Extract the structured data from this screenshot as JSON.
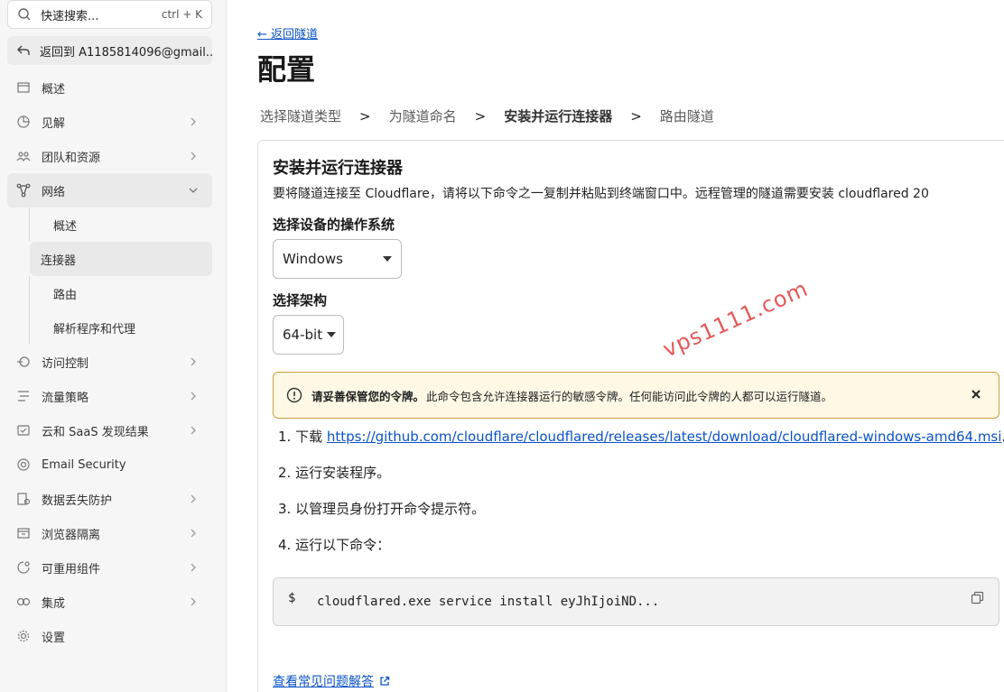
{
  "sidebar": {
    "search": {
      "placeholder": "快速搜索...",
      "shortcut": "ctrl + K"
    },
    "back_account": "返回到 A1185814096@gmail...",
    "items": [
      {
        "label": "概述",
        "icon": "overview-icon"
      },
      {
        "label": "见解",
        "icon": "insights-icon"
      },
      {
        "label": "团队和资源",
        "icon": "team-icon"
      },
      {
        "label": "网络",
        "icon": "network-icon"
      },
      {
        "label": "访问控制",
        "icon": "access-icon"
      },
      {
        "label": "流量策略",
        "icon": "traffic-icon"
      },
      {
        "label": "云和 SaaS 发现结果",
        "icon": "cloud-icon"
      },
      {
        "label": "Email Security",
        "icon": "email-icon"
      },
      {
        "label": "数据丢失防护",
        "icon": "dlp-icon"
      },
      {
        "label": "浏览器隔离",
        "icon": "browser-icon"
      },
      {
        "label": "可重用组件",
        "icon": "component-icon"
      },
      {
        "label": "集成",
        "icon": "integration-icon"
      },
      {
        "label": "设置",
        "icon": "settings-icon"
      }
    ],
    "network_sub": [
      "概述",
      "连接器",
      "路由",
      "解析程序和代理"
    ]
  },
  "main": {
    "back_link": "← 返回隧道",
    "title": "配置",
    "steps": [
      "选择隧道类型",
      "为隧道命名",
      "安装并运行连接器",
      "路由隧道"
    ],
    "step_sep": ">",
    "card": {
      "title": "安装并运行连接器",
      "desc": "要将隧道连接至 Cloudflare，请将以下命令之一复制并粘贴到终端窗口中。远程管理的隧道需要安装 cloudflared 20",
      "os_label": "选择设备的操作系统",
      "os_value": "Windows",
      "arch_label": "选择架构",
      "arch_value": "64-bit",
      "warning_bold": "请妥善保管您的令牌。",
      "warning_text": "此命令包含允许连接器运行的敏感令牌。任何能访问此令牌的人都可以运行隧道。",
      "step1_prefix": "1. 下载 ",
      "step1_link": "https://github.com/cloudflare/cloudflared/releases/latest/download/cloudflared-windows-amd64.msi",
      "step1_suffix": ".",
      "step2": "2. 运行安装程序。",
      "step3": "3. 以管理员身份打开命令提示符。",
      "step4": "4. 运行以下命令：",
      "code_prompt": "$",
      "code_cmd": "cloudflared.exe service install eyJhIjoiND..."
    },
    "faq_link": "查看常见问题解答",
    "watermark": "vps1111.com"
  }
}
